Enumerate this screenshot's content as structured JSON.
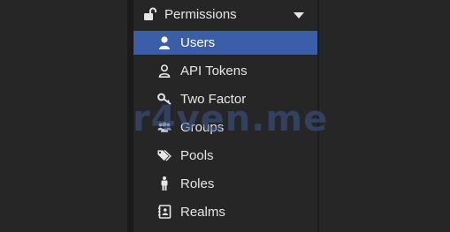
{
  "menu": {
    "header": {
      "label": "Permissions",
      "icon": "unlock-icon",
      "expanded": true
    },
    "items": [
      {
        "label": "Users",
        "icon": "user-icon",
        "active": true
      },
      {
        "label": "API Tokens",
        "icon": "user-outline-icon",
        "active": false
      },
      {
        "label": "Two Factor",
        "icon": "key-icon",
        "active": false
      },
      {
        "label": "Groups",
        "icon": "users-icon",
        "active": false
      },
      {
        "label": "Pools",
        "icon": "tags-icon",
        "active": false
      },
      {
        "label": "Roles",
        "icon": "male-icon",
        "active": false
      },
      {
        "label": "Realms",
        "icon": "address-book-icon",
        "active": false
      }
    ]
  },
  "watermark": {
    "text": "r4ven.me"
  },
  "colors": {
    "background": "#262626",
    "active": "#3a5fa8",
    "text": "#e6e6e6"
  }
}
